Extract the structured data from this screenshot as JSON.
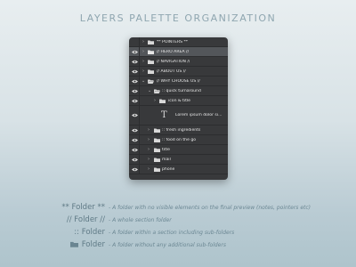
{
  "page": {
    "title": "LAYERS PALETTE ORGANIZATION"
  },
  "layers": [
    {
      "label": "** POINTERS **",
      "selected": false
    },
    {
      "label": "// HERO AREA //",
      "selected": true
    },
    {
      "label": "// NAVIGATION //",
      "selected": false
    },
    {
      "label": "// ABOUT US //",
      "selected": false
    },
    {
      "label": "// WHY CHOOSE US //",
      "selected": false
    },
    {
      "label": ":: quick turnaround",
      "selected": false
    },
    {
      "label": "icon & title",
      "selected": false
    },
    {
      "label": "Lorem ipsum dolor si...",
      "selected": false
    },
    {
      "label": ":: fresh ingredients",
      "selected": false
    },
    {
      "label": ":: food on the go",
      "selected": false
    },
    {
      "label": "title",
      "selected": false
    },
    {
      "label": "mail",
      "selected": false
    },
    {
      "label": "phone",
      "selected": false
    }
  ],
  "legend": [
    {
      "key": "** Folder **",
      "desc": "- A folder with no visible elements on the final preview (notes, pointers etc)"
    },
    {
      "key": "// Folder //",
      "desc": "- A whole section folder"
    },
    {
      "key": ":: Folder",
      "desc": "- A folder within a section including sub-folders"
    },
    {
      "key": "Folder",
      "desc": "- A folder without any additional sub-folders"
    }
  ],
  "colors": {
    "panel": "#38393b",
    "selected_row": "#53565a",
    "title": "#8fa6b0"
  },
  "icons": {
    "visibility": "eye-icon",
    "expand": "chevron-icon",
    "folder": "folder-icon",
    "text_layer": "text-layer-icon"
  }
}
